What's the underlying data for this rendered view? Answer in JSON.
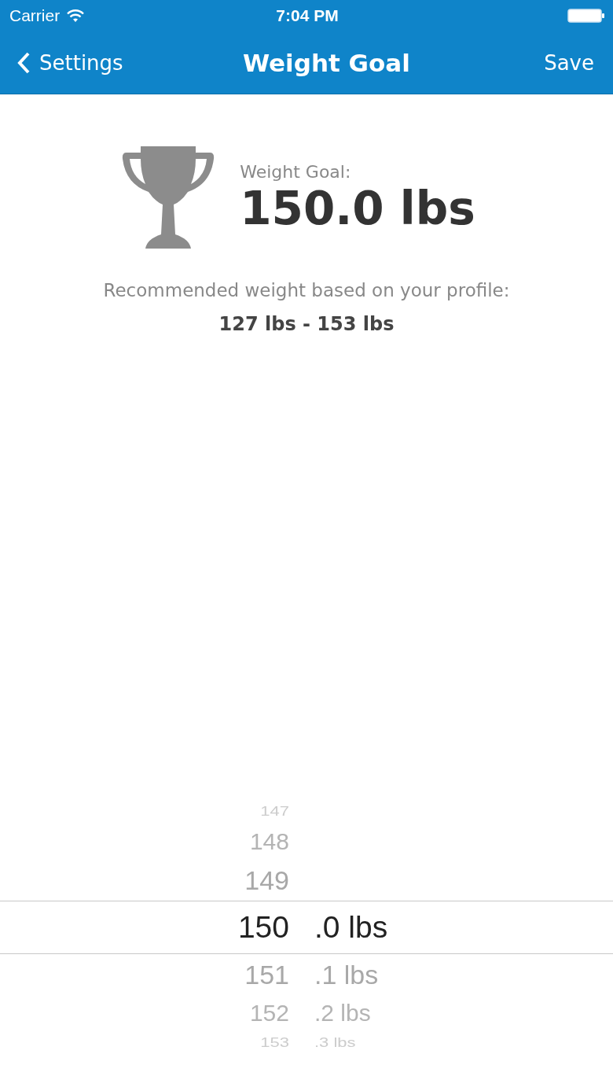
{
  "status_bar": {
    "carrier": "Carrier",
    "time": "7:04 PM"
  },
  "nav_bar": {
    "back": "Settings",
    "title": "Weight Goal",
    "action": "Save"
  },
  "goal": {
    "label": "Weight Goal:",
    "value": "150.0 lbs"
  },
  "recommendation": {
    "text": "Recommended weight based on your profile:",
    "range": "127 lbs - 153 lbs"
  },
  "picker": {
    "rows": [
      {
        "whole": "147",
        "selected": false
      },
      {
        "whole": "148",
        "selected": false
      },
      {
        "whole": "149",
        "selected": false
      },
      {
        "whole": "150",
        "decimal": ".0 lbs",
        "selected": true
      },
      {
        "whole": "151",
        "decimal": ".1 lbs",
        "selected": false
      },
      {
        "whole": "152",
        "decimal": ".2 lbs",
        "selected": false
      },
      {
        "whole": "153",
        "decimal": ".3 lbs",
        "selected": false
      }
    ]
  }
}
